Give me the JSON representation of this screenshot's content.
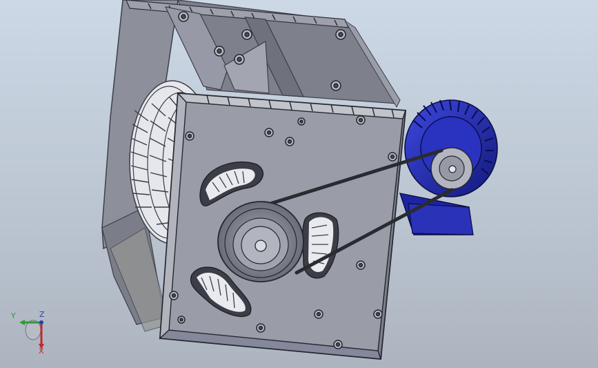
{
  "viewport": {
    "background_top": "#ccd8e6",
    "background_bottom": "#acb4bf"
  },
  "model": {
    "parts": [
      "housing",
      "front-plate",
      "impeller",
      "driven-pulley",
      "drive-belt",
      "motor",
      "motor-pulley"
    ],
    "housing_color": "#8c8e9a",
    "plate_color": "#9698a5",
    "motor_color": "#2b35c4"
  },
  "triad": {
    "x_label": "X",
    "y_label": "Y",
    "z_label": "Z",
    "x_color": "#c22a2a",
    "y_color": "#2f9a3a",
    "z_color": "#2a3fa8"
  }
}
